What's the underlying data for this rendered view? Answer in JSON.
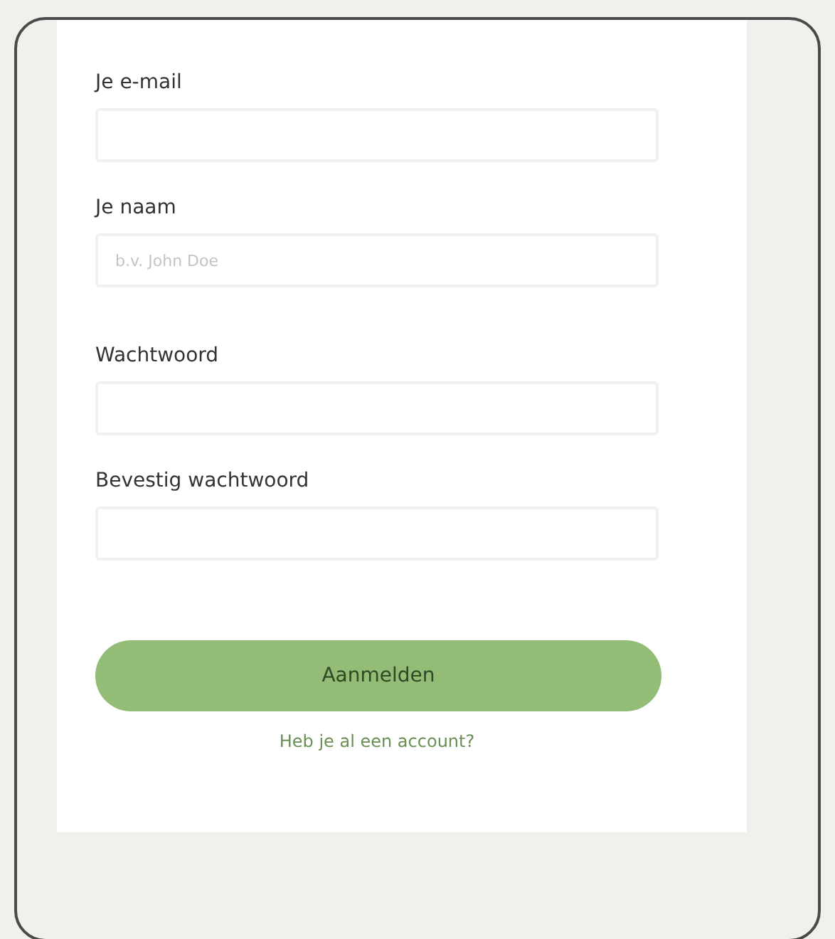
{
  "fields": [
    {
      "label": "Je e-mail"
    },
    {
      "label": "Je naam",
      "placeholder": "b.v. John Doe"
    },
    {
      "label": "Wachtwoord"
    },
    {
      "label": "Bevestig wachtwoord"
    }
  ],
  "submit_button": "Aanmelden",
  "login_link": "Heb je al een account?"
}
